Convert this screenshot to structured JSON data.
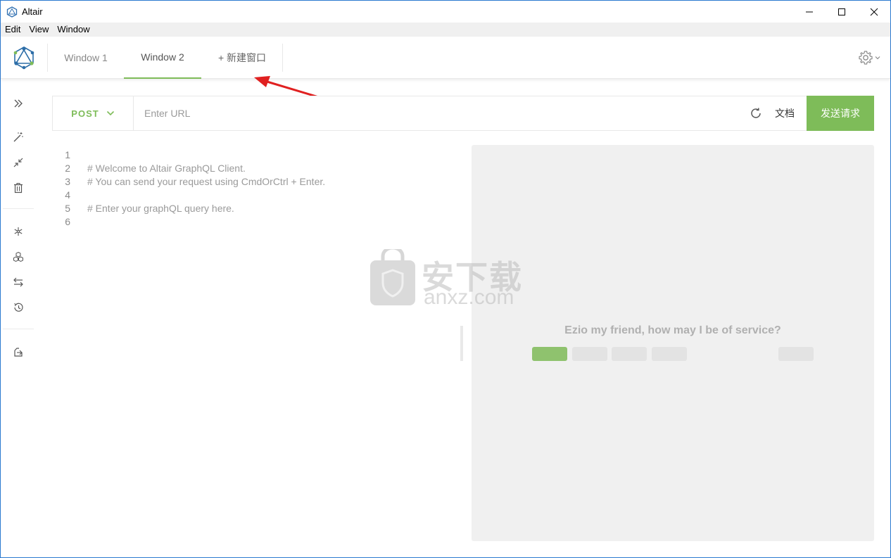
{
  "titlebar": {
    "title": "Altair"
  },
  "menubar": {
    "items": [
      "Edit",
      "View",
      "Window"
    ]
  },
  "tabs": {
    "items": [
      {
        "label": "Window 1",
        "active": false
      },
      {
        "label": "Window 2",
        "active": true
      }
    ],
    "add_label": "+ 新建窗口"
  },
  "request": {
    "method": "POST",
    "url_placeholder": "Enter URL",
    "url_value": "",
    "docs_label": "文档",
    "send_label": "发送请求"
  },
  "editor": {
    "lines": [
      {
        "no": "1",
        "text": ""
      },
      {
        "no": "2",
        "text": "# Welcome to Altair GraphQL Client."
      },
      {
        "no": "3",
        "text": "# You can send your request using CmdOrCtrl + Enter."
      },
      {
        "no": "4",
        "text": ""
      },
      {
        "no": "5",
        "text": "# Enter your graphQL query here."
      },
      {
        "no": "6",
        "text": ""
      }
    ]
  },
  "result": {
    "message": "Ezio my friend, how may I be of service?"
  },
  "watermark": {
    "cn": "安下载",
    "en": "anxz.com"
  },
  "colors": {
    "accent": "#7ebc59",
    "annotation_arrow": "#e02020",
    "window_border": "#2b79d0"
  },
  "icons": {
    "sidebar": [
      "chevrons-right-icon",
      "magic-wand-icon",
      "compress-icon",
      "trash-icon",
      "snowflake-icon",
      "cubes-icon",
      "swap-arrows-icon",
      "history-icon",
      "export-icon"
    ]
  }
}
